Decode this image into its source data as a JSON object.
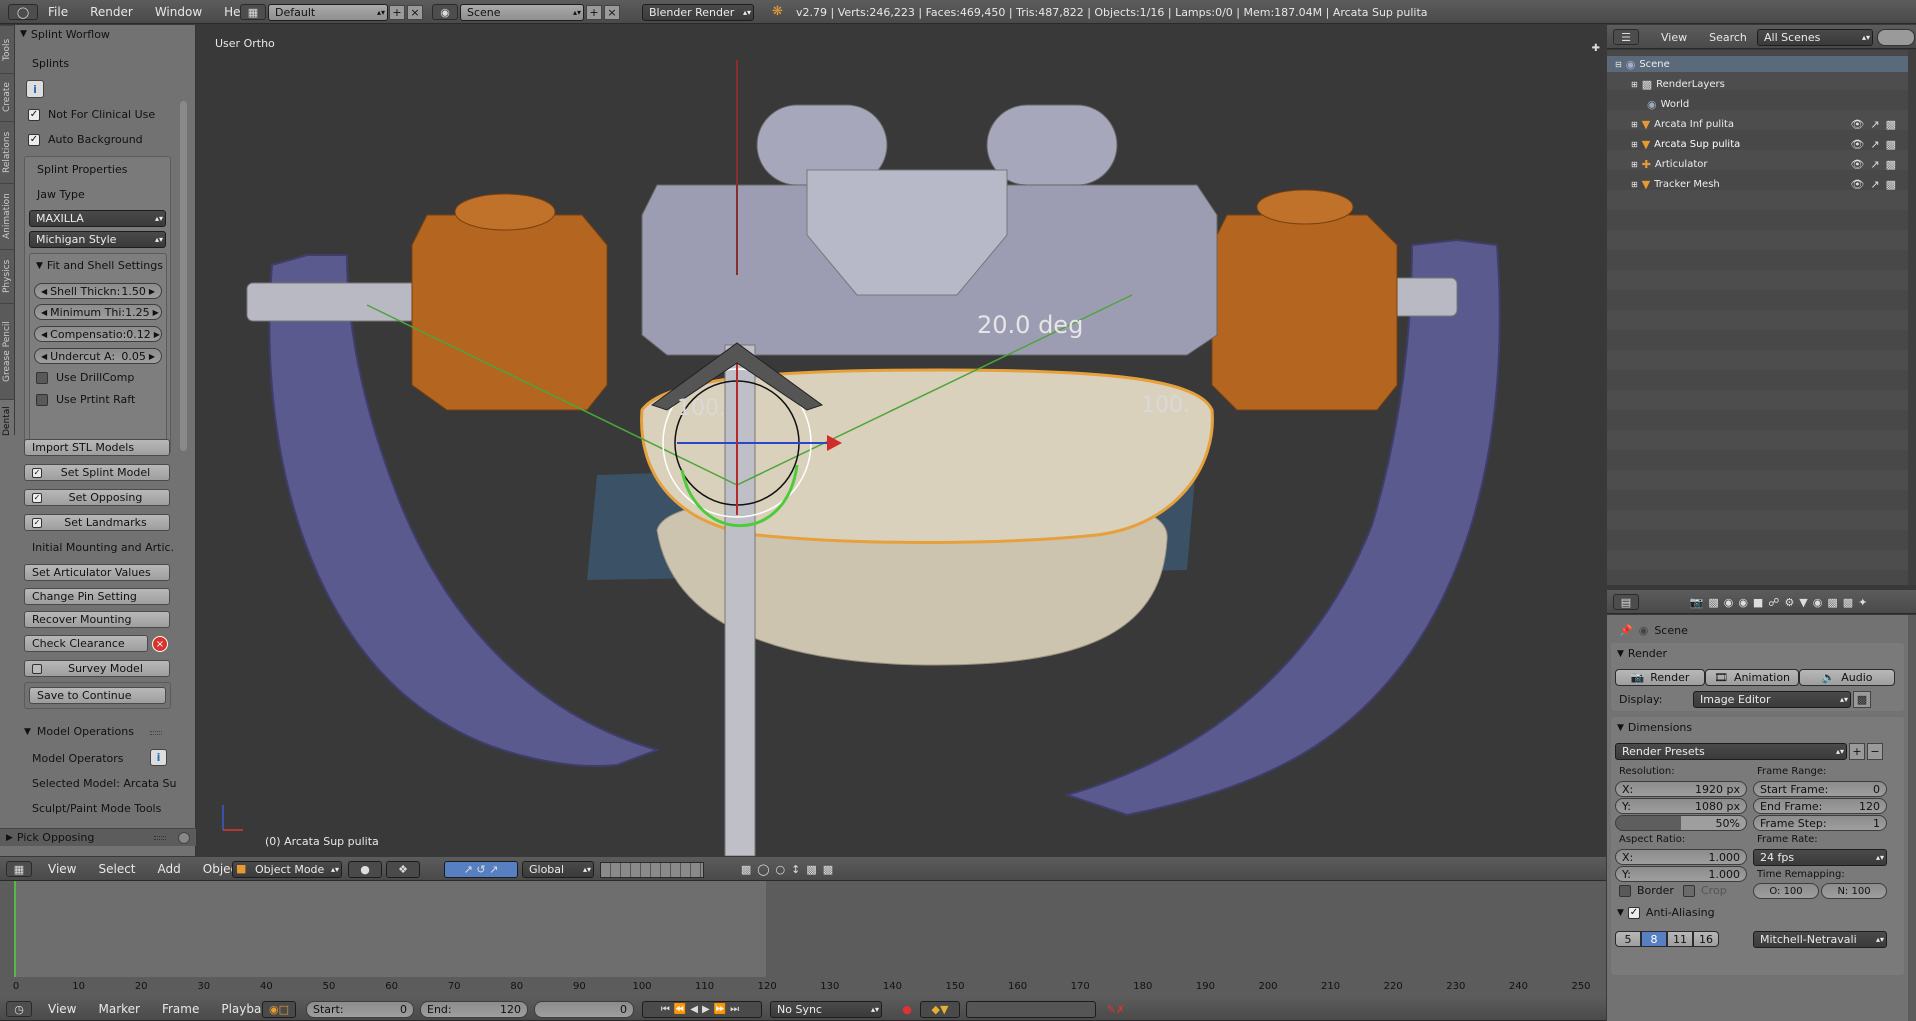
{
  "topbar": {
    "menus": [
      "File",
      "Render",
      "Window",
      "Help"
    ],
    "layout": "Default",
    "scene": "Scene",
    "engine": "Blender Render",
    "stats": "v2.79 | Verts:246,223 | Faces:469,450 | Tris:487,822 | Objects:1/16 | Lamps:0/0 | Mem:187.04M | Arcata Sup pulita"
  },
  "vtabs": [
    "Tools",
    "Create",
    "Relations",
    "Animation",
    "Physics",
    "Grease Pencil",
    "Dental"
  ],
  "left": {
    "workflow_title": "Splint Worflow",
    "splints": "Splints",
    "not_clinical": "Not For Clinical Use",
    "auto_bg": "Auto Background",
    "props_title": "Splint Properties",
    "jaw_type_label": "Jaw Type",
    "jaw_type": "MAXILLA",
    "style": "Michigan Style",
    "fit_title": "Fit and Shell Settings",
    "fields": [
      {
        "label": "Shell Thickn:",
        "value": "1.50"
      },
      {
        "label": "Minimum Thi:",
        "value": "1.25"
      },
      {
        "label": "Compensatio:",
        "value": "0.12"
      },
      {
        "label": "Undercut A:",
        "value": "0.05"
      }
    ],
    "use_drill": "Use DrillComp",
    "use_raft": "Use Prtint Raft",
    "buttons": [
      "Import STL Models",
      "Set Splint Model",
      "Set Opposing",
      "Set Landmarks",
      "Initial Mounting and Artic...",
      "Set Articulator Values",
      "Change Pin Setting",
      "Recover Mounting",
      "Check Clearance",
      "Survey Model"
    ],
    "save": "Save to Continue",
    "model_ops_title": "Model Operations",
    "model_operators": "Model Operators",
    "selected_model": "Selected Model: Arcata Su",
    "sculpt": "Sculpt/Paint Mode Tools",
    "pick_opposing": "Pick Opposing"
  },
  "viewport": {
    "view_label": "User Ortho",
    "object_label": "(0) Arcata Sup pulita",
    "angle": "20.0 deg",
    "left_pct": "100.",
    "right_pct": "100."
  },
  "vp_header": {
    "menus": [
      "View",
      "Select",
      "Add",
      "Object"
    ],
    "mode": "Object Mode",
    "orientation": "Global"
  },
  "timeline": {
    "ticks": [
      "0",
      "10",
      "20",
      "30",
      "40",
      "50",
      "60",
      "70",
      "80",
      "90",
      "100",
      "110",
      "120",
      "130",
      "140",
      "150",
      "160",
      "170",
      "180",
      "190",
      "200",
      "210",
      "220",
      "230",
      "240",
      "250"
    ],
    "menus": [
      "View",
      "Marker",
      "Frame",
      "Playback"
    ],
    "start": "Start:",
    "start_val": "0",
    "end": "End:",
    "end_val": "120",
    "current": "0",
    "sync": "No Sync"
  },
  "outliner": {
    "menus": [
      "View",
      "Search"
    ],
    "filter": "All Scenes",
    "items": [
      {
        "name": "Scene",
        "indent": 0
      },
      {
        "name": "RenderLayers",
        "indent": 1
      },
      {
        "name": "World",
        "indent": 1
      },
      {
        "name": "Arcata Inf pulita",
        "indent": 1
      },
      {
        "name": "Arcata Sup pulita",
        "indent": 1
      },
      {
        "name": "Articulator",
        "indent": 1
      },
      {
        "name": "Tracker Mesh",
        "indent": 1
      }
    ]
  },
  "props": {
    "scene": "Scene",
    "render_title": "Render",
    "render_btn": "Render",
    "anim_btn": "Animation",
    "audio_btn": "Audio",
    "display_label": "Display:",
    "display": "Image Editor",
    "dims_title": "Dimensions",
    "presets": "Render Presets",
    "resolution": "Resolution:",
    "res_x_label": "X:",
    "res_x": "1920 px",
    "res_y_label": "Y:",
    "res_y": "1080 px",
    "res_pct": "50%",
    "frame_range": "Frame Range:",
    "start_frame_label": "Start Frame:",
    "start_frame": "0",
    "end_frame_label": "End Frame:",
    "end_frame": "120",
    "frame_step_label": "Frame Step:",
    "frame_step": "1",
    "aspect": "Aspect Ratio:",
    "asp_x_label": "X:",
    "asp_x": "1.000",
    "asp_y_label": "Y:",
    "asp_y": "1.000",
    "frame_rate_label": "Frame Rate:",
    "frame_rate": "24 fps",
    "time_remap": "Time Remapping:",
    "remap_o": "O: 100",
    "remap_n": "N: 100",
    "border": "Border",
    "crop": "Crop",
    "aa_title": "Anti-Aliasing",
    "aa_samples": [
      "5",
      "8",
      "11",
      "16"
    ],
    "aa_filter": "Mitchell-Netravali"
  }
}
